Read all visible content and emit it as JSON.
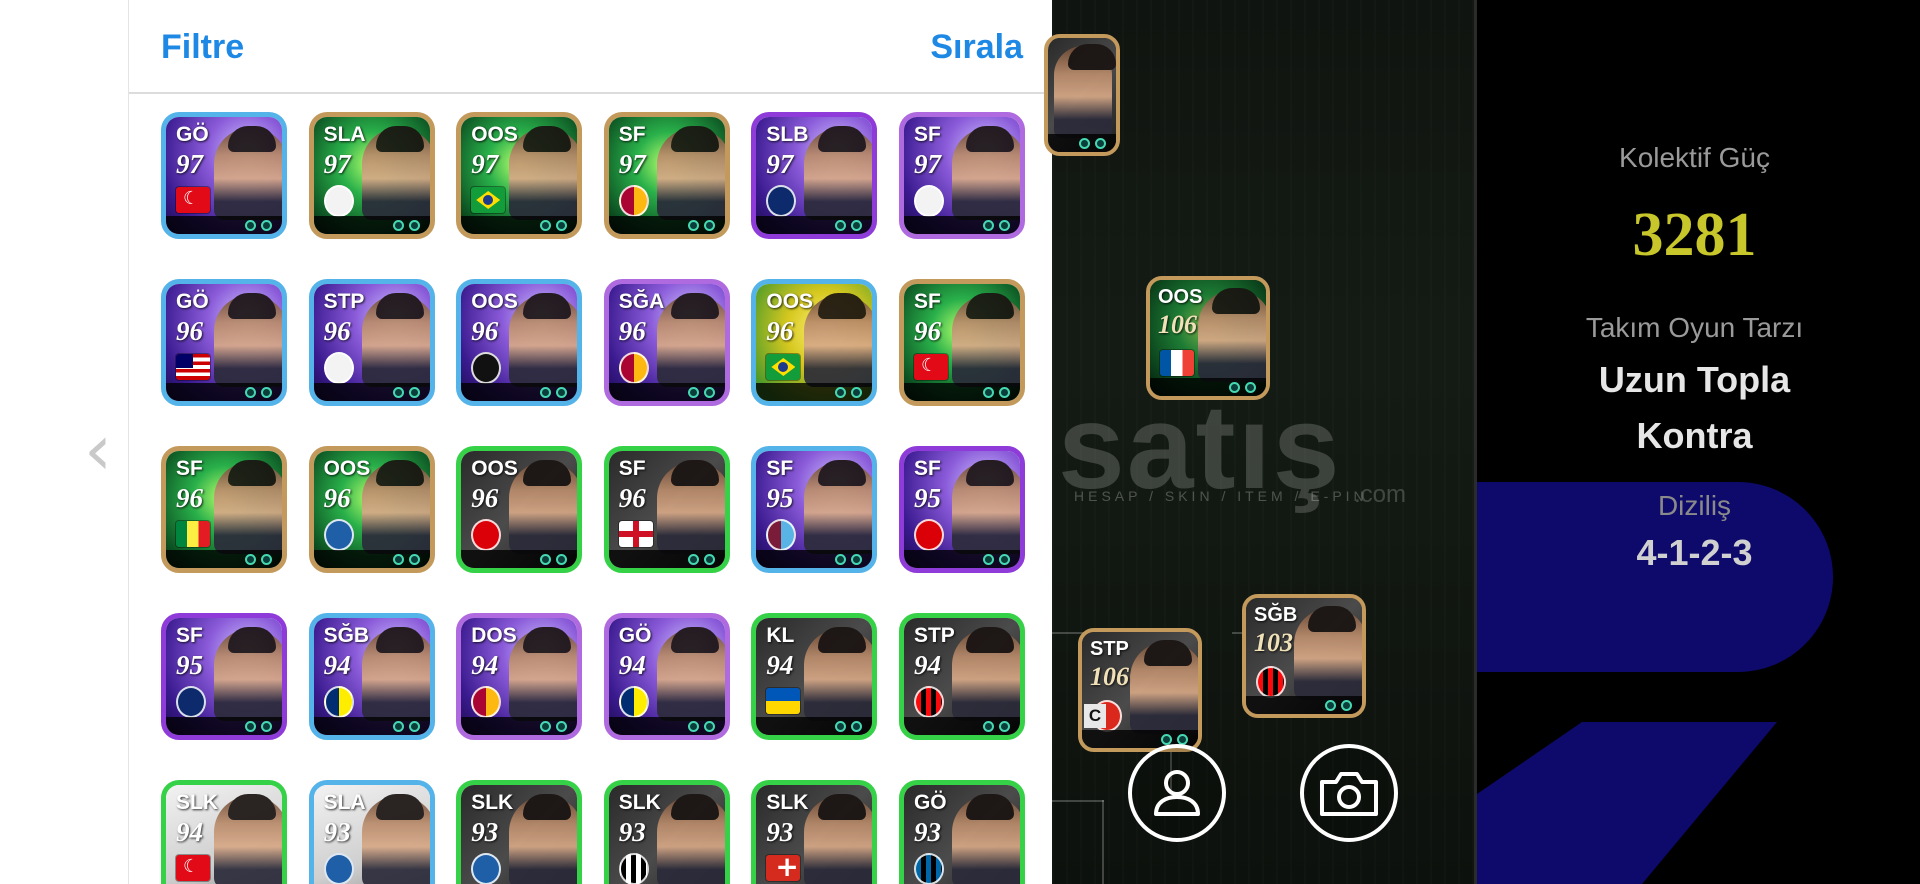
{
  "header": {
    "filter_label": "Filtre",
    "sort_label": "Sırala"
  },
  "cards": [
    {
      "pos": "GÖ",
      "rating": "97",
      "emblem": "flag-tr",
      "bg": "bg-purple",
      "frame": "blue"
    },
    {
      "pos": "SLA",
      "rating": "97",
      "emblem": "club-white",
      "bg": "bg-green",
      "frame": "gold"
    },
    {
      "pos": "OOS",
      "rating": "97",
      "emblem": "flag-br",
      "bg": "bg-green",
      "frame": "gold"
    },
    {
      "pos": "SF",
      "rating": "97",
      "emblem": "club-gs",
      "bg": "bg-green",
      "frame": "gold"
    },
    {
      "pos": "SLB",
      "rating": "97",
      "emblem": "club-psg",
      "bg": "bg-purple",
      "frame": "purple"
    },
    {
      "pos": "SF",
      "rating": "97",
      "emblem": "club-white",
      "bg": "bg-purple",
      "frame": "lavender"
    },
    {
      "pos": "GÖ",
      "rating": "96",
      "emblem": "flag-my",
      "bg": "bg-purple",
      "frame": "blue"
    },
    {
      "pos": "STP",
      "rating": "96",
      "emblem": "club-white",
      "bg": "bg-purple",
      "frame": "blue"
    },
    {
      "pos": "OOS",
      "rating": "96",
      "emblem": "club-bjk",
      "bg": "bg-purple",
      "frame": "blue"
    },
    {
      "pos": "SĞA",
      "rating": "96",
      "emblem": "club-gs",
      "bg": "bg-purple",
      "frame": "lavender"
    },
    {
      "pos": "OOS",
      "rating": "96",
      "emblem": "flag-br",
      "bg": "bg-yellow",
      "frame": "blue"
    },
    {
      "pos": "SF",
      "rating": "96",
      "emblem": "flag-tr",
      "bg": "bg-green",
      "frame": "gold"
    },
    {
      "pos": "SF",
      "rating": "96",
      "emblem": "flag-sn",
      "bg": "bg-green",
      "frame": "gold"
    },
    {
      "pos": "OOS",
      "rating": "96",
      "emblem": "club-generic",
      "bg": "bg-green",
      "frame": "gold"
    },
    {
      "pos": "OOS",
      "rating": "96",
      "emblem": "club-arsenal",
      "bg": "bg-dark",
      "frame": "green"
    },
    {
      "pos": "SF",
      "rating": "96",
      "emblem": "flag-en",
      "bg": "bg-dark",
      "frame": "green"
    },
    {
      "pos": "SF",
      "rating": "95",
      "emblem": "club-ts",
      "bg": "bg-purple",
      "frame": "blue"
    },
    {
      "pos": "SF",
      "rating": "95",
      "emblem": "club-arsenal",
      "bg": "bg-purple",
      "frame": "purple"
    },
    {
      "pos": "SF",
      "rating": "95",
      "emblem": "club-psg",
      "bg": "bg-purple",
      "frame": "purple"
    },
    {
      "pos": "SĞB",
      "rating": "94",
      "emblem": "club-fb",
      "bg": "bg-purple",
      "frame": "blue"
    },
    {
      "pos": "DOS",
      "rating": "94",
      "emblem": "club-gs",
      "bg": "bg-purple",
      "frame": "lavender"
    },
    {
      "pos": "GÖ",
      "rating": "94",
      "emblem": "club-fb",
      "bg": "bg-purple",
      "frame": "lavender"
    },
    {
      "pos": "KL",
      "rating": "94",
      "emblem": "flag-ua",
      "bg": "bg-dark",
      "frame": "green"
    },
    {
      "pos": "STP",
      "rating": "94",
      "emblem": "club-milan",
      "bg": "bg-dark",
      "frame": "green"
    },
    {
      "pos": "SLK",
      "rating": "94",
      "emblem": "flag-tr",
      "bg": "bg-white",
      "frame": "green"
    },
    {
      "pos": "SLA",
      "rating": "93",
      "emblem": "club-generic",
      "bg": "bg-white",
      "frame": "blue"
    },
    {
      "pos": "SLK",
      "rating": "93",
      "emblem": "club-generic",
      "bg": "bg-dark",
      "frame": "green"
    },
    {
      "pos": "SLK",
      "rating": "93",
      "emblem": "club-juve",
      "bg": "bg-dark",
      "frame": "green"
    },
    {
      "pos": "SLK",
      "rating": "93",
      "emblem": "flag-ch",
      "bg": "bg-dark",
      "frame": "green"
    },
    {
      "pos": "GÖ",
      "rating": "93",
      "emblem": "club-inter",
      "bg": "bg-dark",
      "frame": "green"
    }
  ],
  "pitch": {
    "players": [
      {
        "pos": "",
        "rating": "",
        "emblem": "club-generic",
        "name": "pitch-player-top"
      },
      {
        "pos": "OOS",
        "rating": "106",
        "emblem": "flag-fr",
        "name": "pitch-player-oos"
      },
      {
        "pos": "STP",
        "rating": "106",
        "emblem": "club-mu",
        "name": "pitch-player-stp",
        "captain": "C"
      },
      {
        "pos": "SĞB",
        "rating": "103",
        "emblem": "club-milan",
        "name": "pitch-player-sgb"
      }
    ],
    "watermark": "satış",
    "watermark_sub": "HESAP / SKIN / ITEM / E-PIN",
    "watermark_com": ".com"
  },
  "team_info": {
    "collective_strength_label": "Kolektif Güç",
    "collective_strength_value": "3281",
    "play_style_label": "Takım Oyun Tarzı",
    "play_style_value_line1": "Uzun Topla",
    "play_style_value_line2": "Kontra",
    "formation_label": "Diziliş",
    "formation_value": "4-1-2-3"
  },
  "colors": {
    "accent": "#1e88e5",
    "strength": "#c7c62a",
    "info_bg": "#000000",
    "info_shape": "#0d0a6b"
  }
}
